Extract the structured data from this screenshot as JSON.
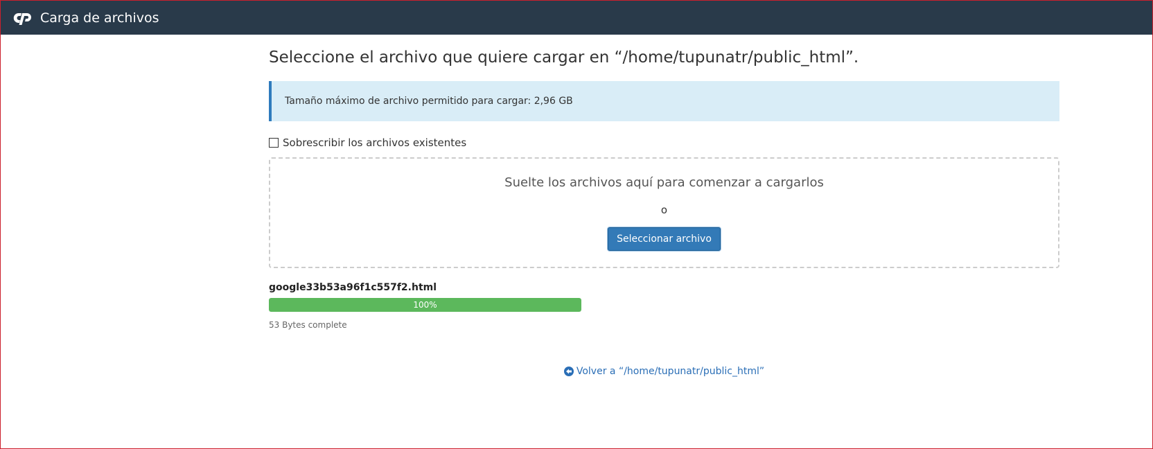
{
  "header": {
    "title": "Carga de archivos",
    "logo_icon": "cpanel-logo-icon",
    "background": "#293a4a"
  },
  "main": {
    "page_title": "Seleccione el archivo que quiere cargar en “/home/tupunatr/public_html”.",
    "alert_text": "Tamaño máximo de archivo permitido para cargar: 2,96 GB",
    "overwrite_label": "Sobrescribir los archivos existentes",
    "overwrite_checked": false,
    "dropzone": {
      "text": "Suelte los archivos aquí para comenzar a cargarlos",
      "or_text": "o",
      "button_label": "Seleccionar archivo"
    },
    "uploads": [
      {
        "file_name": "google33b53a96f1c557f2.html",
        "progress": 100,
        "progress_label": "100%",
        "status": "53 Bytes complete"
      }
    ],
    "back_link": "Volver a “/home/tupunatr/public_html”",
    "back_icon": "arrow-circle-left-icon"
  },
  "colors": {
    "accent": "#337ab7",
    "progress": "#5cb85c",
    "alert_bg": "#d9edf7",
    "link": "#2a6eb6"
  }
}
